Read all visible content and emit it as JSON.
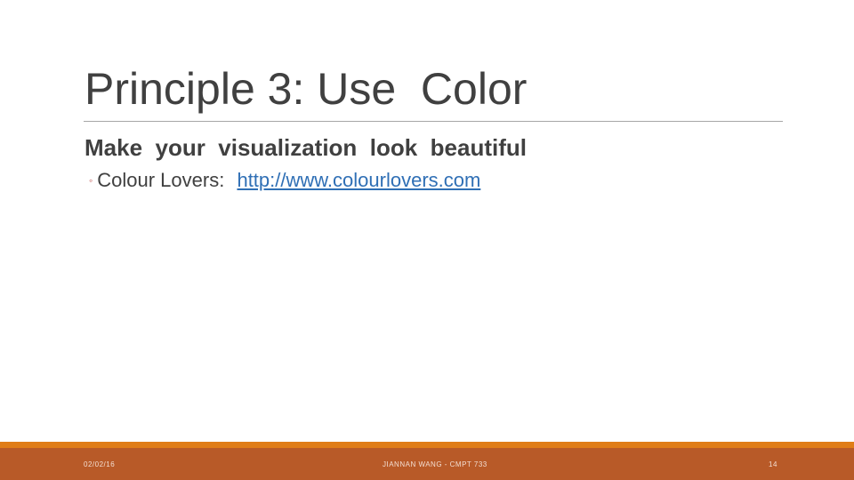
{
  "slide": {
    "title": "Principle 3: Use  Color",
    "heading": "Make  your  visualization  look  beautiful",
    "bullet": {
      "icon": "◦",
      "icon_name": "ring-bullet-icon",
      "label": "Colour Lovers: ",
      "link_text": "http://www.colourlovers.com"
    }
  },
  "footer": {
    "date": "02/02/16",
    "center": "JIANNAN WANG - CMPT 733",
    "page_number": "14"
  },
  "colors": {
    "title_text": "#404040",
    "link": "#2f6fb5",
    "footer_accent": "#e07d18",
    "footer_bar": "#b85a28"
  }
}
